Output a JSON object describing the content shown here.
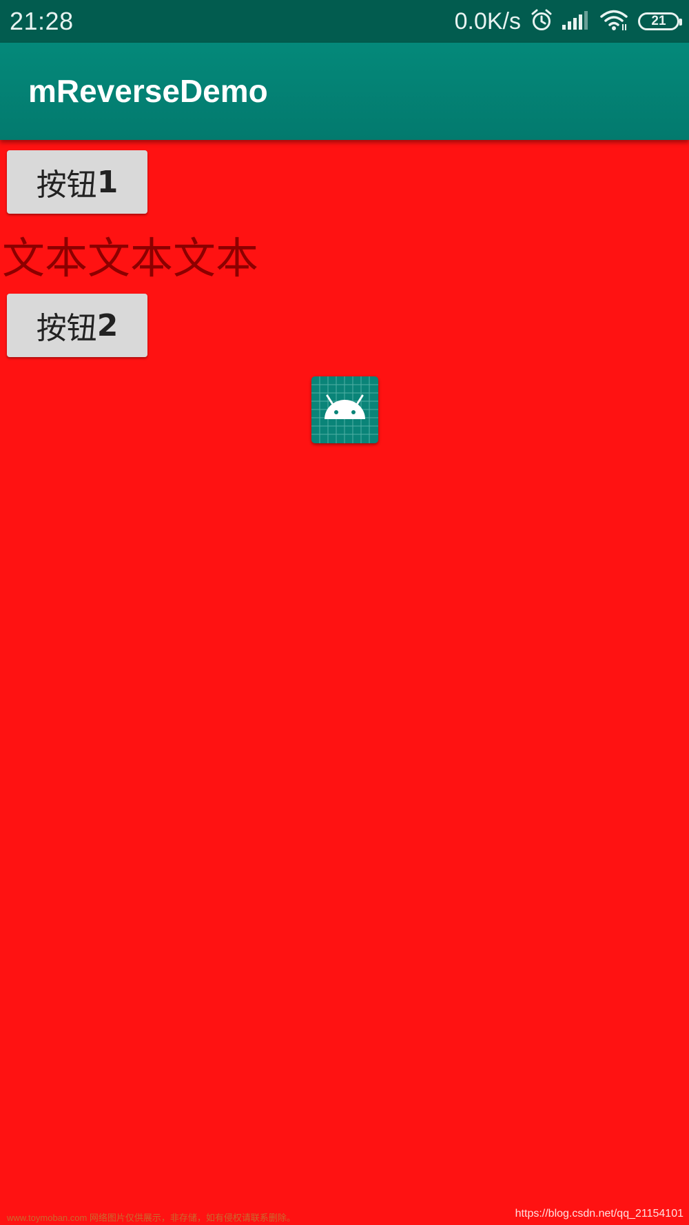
{
  "status_bar": {
    "time": "21:28",
    "net_speed": "0.0K/s",
    "battery_level": "21",
    "icons": [
      "alarm-icon",
      "signal-icon",
      "wifi-icon",
      "battery-icon"
    ]
  },
  "app_bar": {
    "title": "mReverseDemo",
    "color": "#04897a"
  },
  "content": {
    "background_color": "#ff1212",
    "button1": {
      "text": "按钮",
      "num": "1"
    },
    "text_view": "文本文本文本",
    "button2": {
      "text": "按钮",
      "num": "2"
    },
    "image_icon": "android-icon"
  },
  "footer": {
    "left_text": "www.toymoban.com 网络图片仅供展示，非存储，如有侵权请联系删除。",
    "right_text": "https://blog.csdn.net/qq_21154101"
  }
}
